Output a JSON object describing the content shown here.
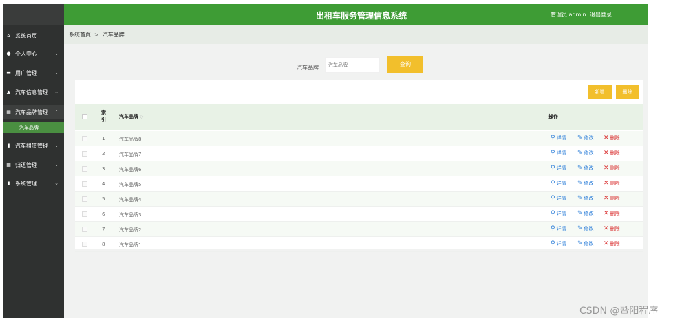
{
  "header": {
    "title": "出租车服务管理信息系统",
    "user": "管理员 admin",
    "logout": "退出登录"
  },
  "sidebar": {
    "items": [
      {
        "label": "系统首页",
        "icon": "home-icon"
      },
      {
        "label": "个人中心",
        "icon": "user-icon"
      },
      {
        "label": "用户管理",
        "icon": "card-icon"
      },
      {
        "label": "汽车信息管理",
        "icon": "car-icon"
      },
      {
        "label": "汽车品牌管理",
        "icon": "grid-icon"
      },
      {
        "label": "汽车租赁管理",
        "icon": "doc-icon"
      },
      {
        "label": "归还管理",
        "icon": "grid-icon"
      },
      {
        "label": "系统管理",
        "icon": "doc-icon"
      }
    ],
    "sub_item": "汽车品牌"
  },
  "breadcrumb": {
    "home": "系统首页",
    "sep": ">",
    "current": "汽车品牌"
  },
  "search": {
    "label": "汽车品牌",
    "placeholder": "汽车品牌",
    "button": "查询"
  },
  "toolbar": {
    "add": "新增",
    "delete": "删除"
  },
  "table": {
    "headers": {
      "index": "索引",
      "brand": "汽车品牌",
      "sort": "◇",
      "ops": "操作"
    },
    "rows": [
      {
        "index": "1",
        "brand": "汽车品牌8"
      },
      {
        "index": "2",
        "brand": "汽车品牌7"
      },
      {
        "index": "3",
        "brand": "汽车品牌6"
      },
      {
        "index": "4",
        "brand": "汽车品牌5"
      },
      {
        "index": "5",
        "brand": "汽车品牌4"
      },
      {
        "index": "6",
        "brand": "汽车品牌3"
      },
      {
        "index": "7",
        "brand": "汽车品牌2"
      },
      {
        "index": "8",
        "brand": "汽车品牌1"
      }
    ],
    "actions": {
      "detail": "详情",
      "edit": "修改",
      "delete": "删除"
    }
  },
  "watermark": "CSDN @暨阳程序",
  "colors": {
    "header": "#3e9c35",
    "sidebar": "#2f3130",
    "button": "#f2bf2c",
    "link": "#2e7fd9",
    "danger": "#d93030"
  }
}
